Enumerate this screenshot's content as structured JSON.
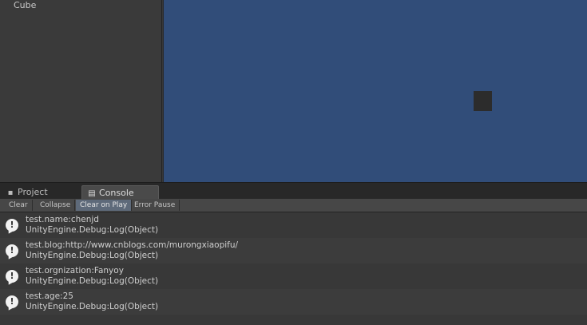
{
  "hierarchy": {
    "items": [
      "Cube"
    ]
  },
  "tabs": {
    "project": "Project",
    "console": "Console"
  },
  "toolbar": {
    "clear": "Clear",
    "collapse": "Collapse",
    "clear_on_play": "Clear on Play",
    "error_pause": "Error Pause"
  },
  "log": [
    {
      "message": "test.name:chenjd",
      "source": "UnityEngine.Debug:Log(Object)"
    },
    {
      "message": "test.blog:http://www.cnblogs.com/murongxiaopifu/",
      "source": "UnityEngine.Debug:Log(Object)"
    },
    {
      "message": "test.orgnization:Fanyoy",
      "source": "UnityEngine.Debug:Log(Object)"
    },
    {
      "message": "test.age:25",
      "source": "UnityEngine.Debug:Log(Object)"
    }
  ],
  "icons": {
    "entry": "info-speech-bubble-icon",
    "console_tab": "console-icon",
    "project_tab": "folder-icon"
  },
  "colors": {
    "scene_background": "#314d79",
    "panel": "#383838",
    "active_toggle": "#5e6a7a"
  }
}
